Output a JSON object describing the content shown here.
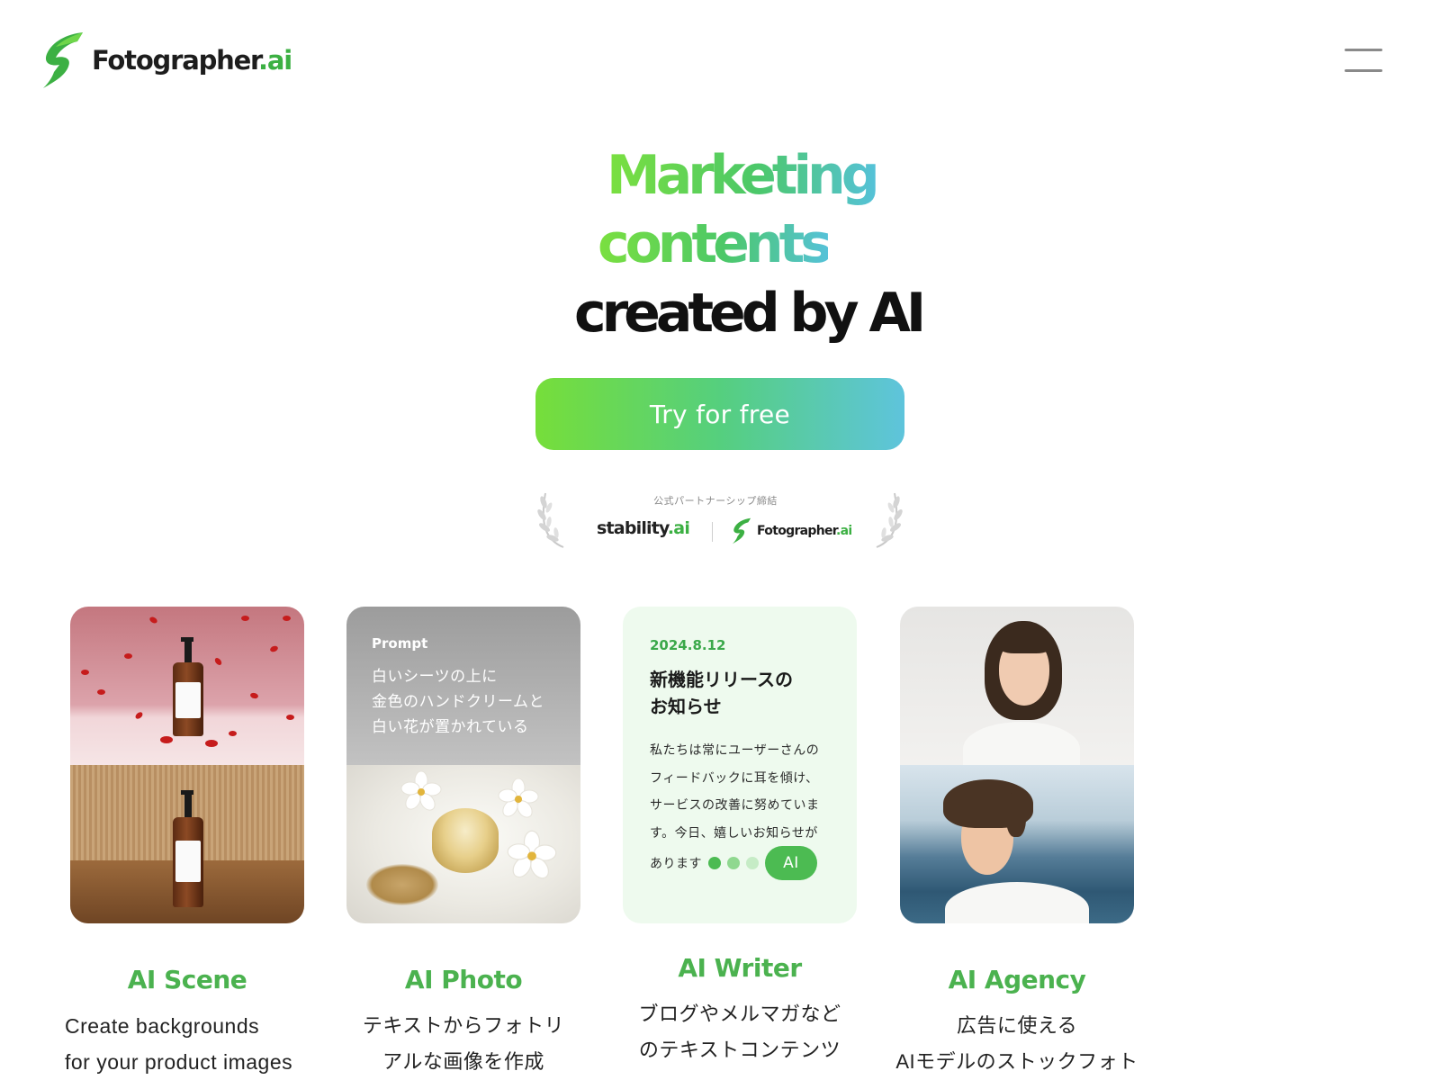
{
  "header": {
    "logo_text": "Fotographer",
    "logo_suffix": ".ai",
    "menu_icon": "hamburger-menu-icon"
  },
  "hero": {
    "line1": "Marketing",
    "line2": "contents",
    "line3": "created by AI",
    "gradient_colors": [
      "#7be03f",
      "#4cc868",
      "#55c2d8"
    ]
  },
  "cta": {
    "label": "Try for free"
  },
  "partnership": {
    "caption": "公式パートナーシップ締結",
    "partner_name": "stability",
    "partner_suffix": ".ai",
    "own_logo_text": "Fotographer",
    "own_logo_suffix": ".ai"
  },
  "features": [
    {
      "title": "AI Scene",
      "description_lines": [
        "Create backgrounds",
        "for your product images"
      ]
    },
    {
      "title": "AI Photo",
      "prompt_label": "Prompt",
      "prompt_lines": [
        "白いシーツの上に",
        "金色のハンドクリームと",
        "白い花が置かれている"
      ],
      "description_lines": [
        "テキストからフォトリ",
        "アルな画像を作成"
      ]
    },
    {
      "title": "AI Writer",
      "card_date": "2024.8.12",
      "card_title_lines": [
        "新機能リリースの",
        "お知らせ"
      ],
      "card_body_lines": [
        "私たちは常にユーザーさんの",
        "フィードバックに耳を傾け、",
        "サービスの改善に努めていま",
        "す。今日、嬉しいお知らせが",
        "あります"
      ],
      "ai_badge": "AI",
      "description_lines": [
        "ブログやメルマガなど",
        "のテキストコンテンツ"
      ]
    },
    {
      "title": "AI Agency",
      "description_lines": [
        "広告に使える",
        "AIモデルのストックフォト"
      ]
    }
  ],
  "colors": {
    "brand_green": "#4bb24f",
    "writer_card_bg": "#eefaee",
    "dot_colors": [
      "#4cbb52",
      "#8fd88f",
      "#c6ecc6"
    ]
  }
}
